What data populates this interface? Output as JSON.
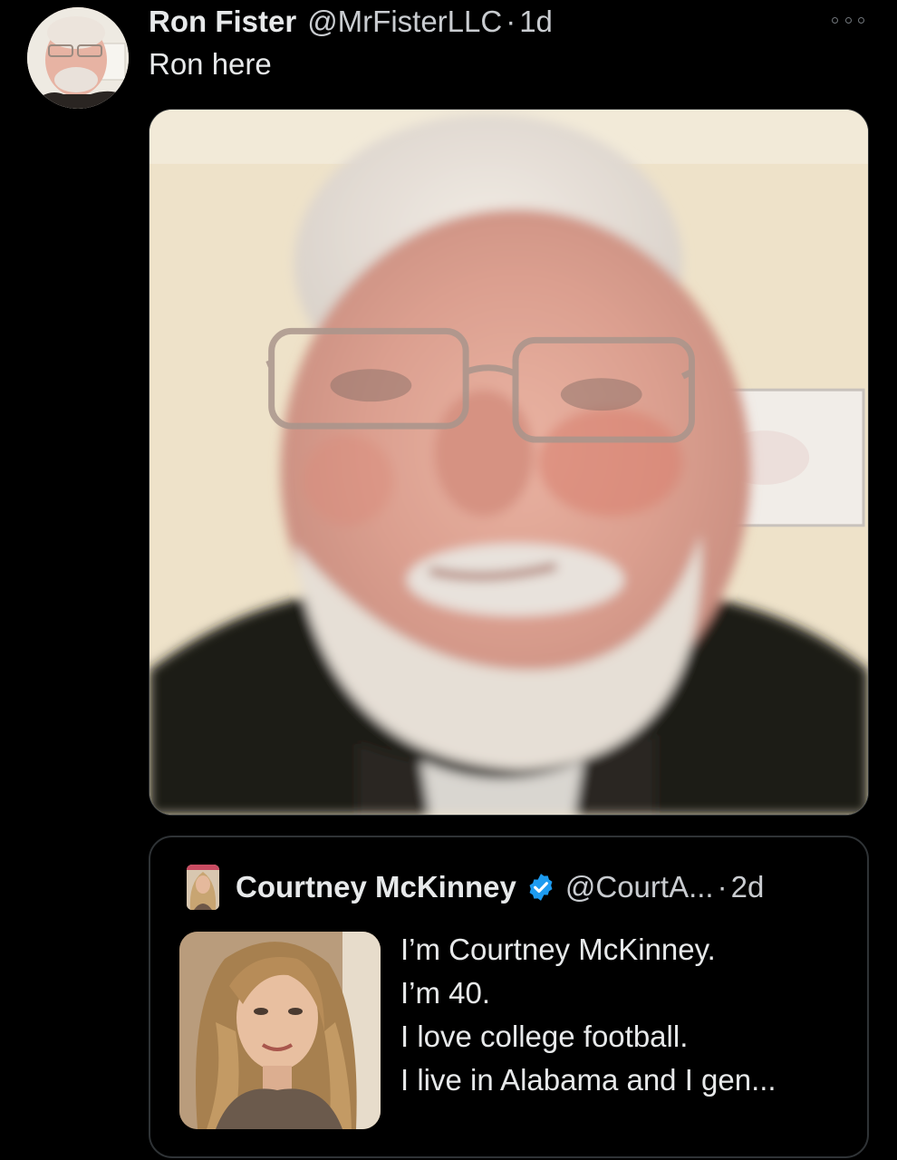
{
  "tweet": {
    "display_name": "Ron Fister",
    "handle": "@MrFisterLLC",
    "separator": "·",
    "time": "1d",
    "text": "Ron here",
    "more_icon": "more-horizontal-icon"
  },
  "quote": {
    "display_name": "Courtney McKinney",
    "verified_icon": "verified-badge-icon",
    "handle": "@CourtA...",
    "separator": "·",
    "time": "2d",
    "lines": [
      "I’m Courtney McKinney.",
      "I’m 40.",
      "I love college football.",
      "I live in Alabama and I gen..."
    ]
  },
  "colors": {
    "background": "#000000",
    "text_primary": "#e7e9ea",
    "text_secondary": "#c9ccd0",
    "border": "#2f3336",
    "verified_blue": "#1d9bf0"
  }
}
